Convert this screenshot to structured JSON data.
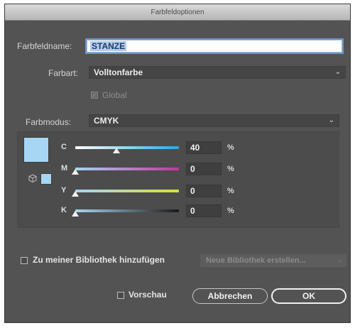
{
  "window": {
    "title": "Farbfeldoptionen"
  },
  "swatch_name": {
    "label": "Farbfeldname:",
    "value": "STANZE"
  },
  "color_type": {
    "label": "Farbart:",
    "value": "Volltonfarbe"
  },
  "global": {
    "label": "Global",
    "checked": true,
    "enabled": false
  },
  "color_mode": {
    "label": "Farbmodus:",
    "value": "CMYK"
  },
  "swatch_color": "#a6d6f4",
  "channels": [
    {
      "label": "C",
      "value": "40",
      "unit": "%",
      "fraction": 0.4,
      "gradient": "linear-gradient(90deg,#ffffff,#27a9e1)"
    },
    {
      "label": "M",
      "value": "0",
      "unit": "%",
      "fraction": 0.0,
      "gradient": "linear-gradient(90deg,#a6d6f4,#c4359a)"
    },
    {
      "label": "Y",
      "value": "0",
      "unit": "%",
      "fraction": 0.0,
      "gradient": "linear-gradient(90deg,#a6d6f4,#d8e033)"
    },
    {
      "label": "K",
      "value": "0",
      "unit": "%",
      "fraction": 0.0,
      "gradient": "linear-gradient(90deg,#a6d6f4,#1a1a1a)"
    }
  ],
  "library": {
    "label": "Zu meiner Bibliothek hinzufügen",
    "select_placeholder": "Neue Bibliothek erstellen..."
  },
  "preview": {
    "label": "Vorschau"
  },
  "buttons": {
    "cancel": "Abbrechen",
    "ok": "OK"
  }
}
